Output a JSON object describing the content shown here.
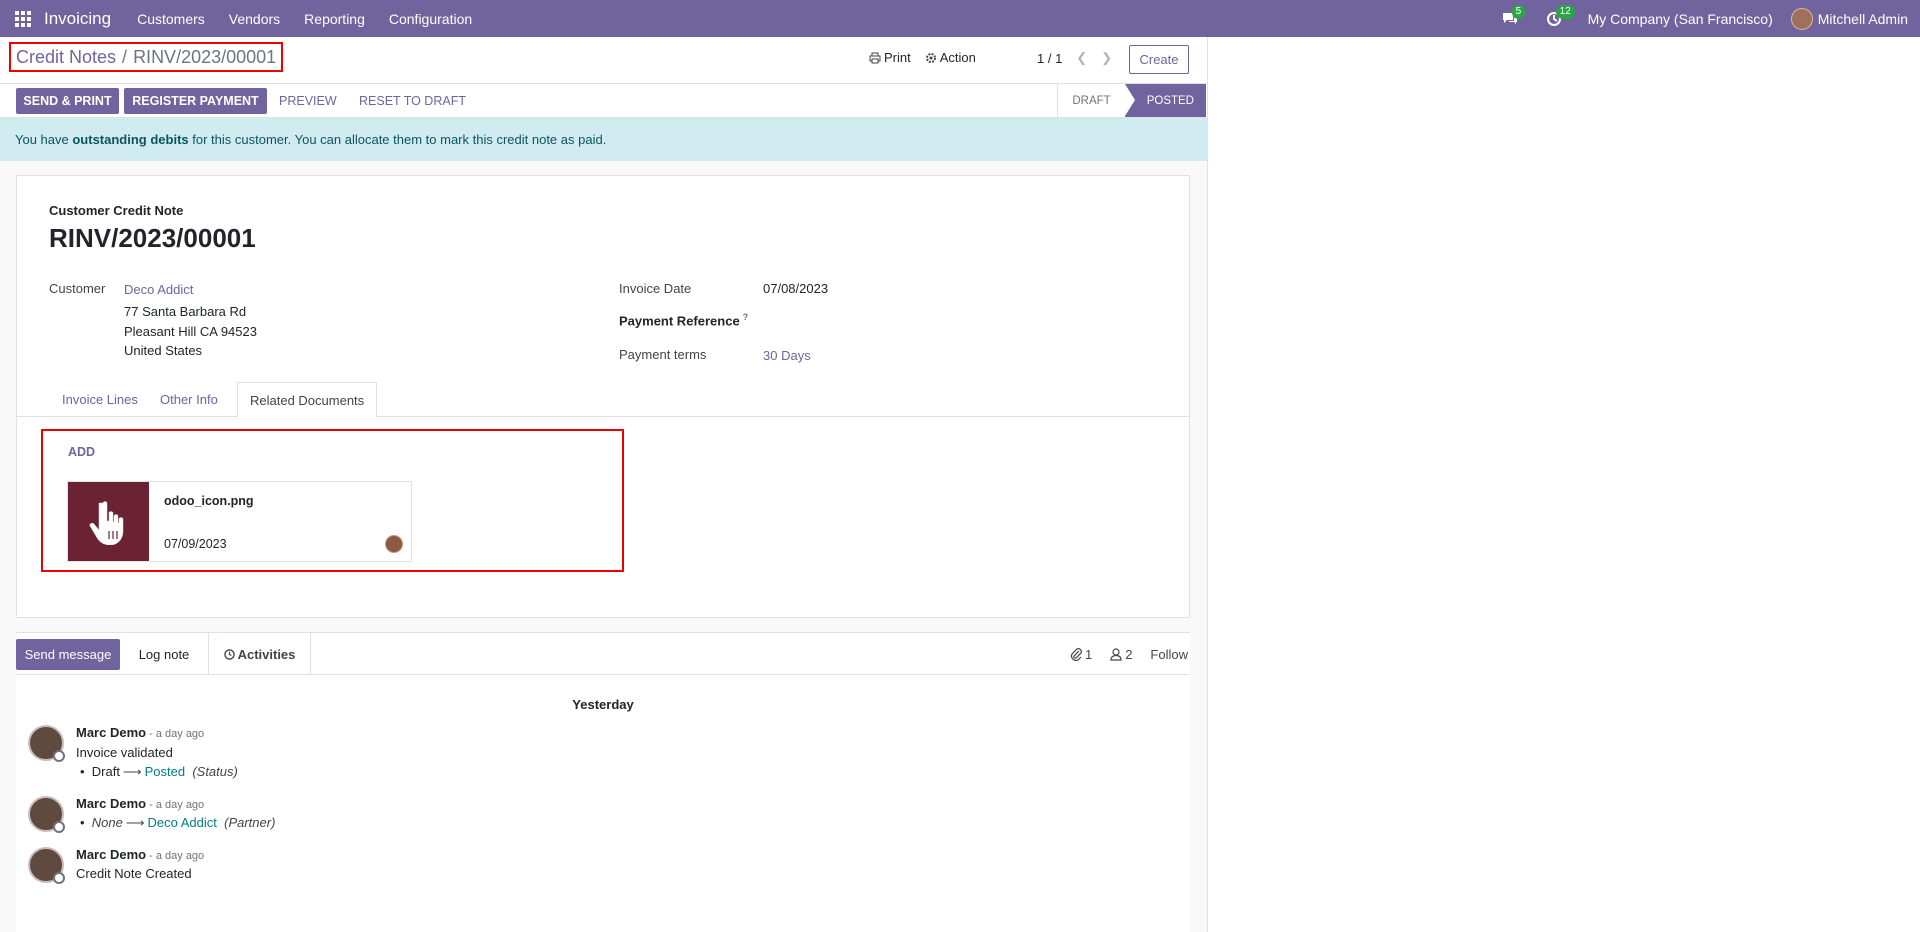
{
  "navbar": {
    "brand": "Invoicing",
    "menu": [
      "Customers",
      "Vendors",
      "Reporting",
      "Configuration"
    ],
    "messages_count": "5",
    "activities_count": "12",
    "company": "My Company (San Francisco)",
    "user": "Mitchell Admin"
  },
  "breadcrumb": {
    "parent": "Credit Notes",
    "separator": "/",
    "current": "RINV/2023/00001"
  },
  "cp": {
    "print": "Print",
    "action": "Action",
    "pager": "1 / 1",
    "create": "Create"
  },
  "statusbar": {
    "send_print": "SEND & PRINT",
    "register_payment": "REGISTER PAYMENT",
    "preview": "PREVIEW",
    "reset_draft": "RESET TO DRAFT",
    "stage_draft": "DRAFT",
    "stage_posted": "POSTED"
  },
  "alert": {
    "pre": "You have ",
    "bold": "outstanding debits",
    "post": " for this customer. You can allocate them to mark this credit note as paid."
  },
  "form": {
    "doc_type": "Customer Credit Note",
    "doc_number": "RINV/2023/00001",
    "customer_label": "Customer",
    "customer_name": "Deco Addict",
    "address_1": "77 Santa Barbara Rd",
    "address_2": "Pleasant Hill CA 94523",
    "address_3": "United States",
    "invoice_date_label": "Invoice Date",
    "invoice_date": "07/08/2023",
    "payment_ref_label": "Payment Reference",
    "payment_ref_help": "?",
    "payment_terms_label": "Payment terms",
    "payment_terms": "30 Days"
  },
  "tabs": [
    "Invoice Lines",
    "Other Info",
    "Related Documents"
  ],
  "attachments": {
    "add": "ADD",
    "file_name": "odoo_icon.png",
    "file_date": "07/09/2023"
  },
  "chatter": {
    "send_message": "Send message",
    "log_note": "Log note",
    "activities": "Activities",
    "attachments_count": "1",
    "followers_count": "2",
    "follow": "Follow",
    "day": "Yesterday",
    "messages": [
      {
        "author": "Marc Demo",
        "time": " - a day ago",
        "body": "Invoice validated",
        "old": "Draft",
        "new": "Posted",
        "field": "(Status)"
      },
      {
        "author": "Marc Demo",
        "time": " - a day ago",
        "old": "None",
        "new": "Deco Addict",
        "field": "(Partner)"
      },
      {
        "author": "Marc Demo",
        "time": " - a day ago",
        "body": "Credit Note Created"
      }
    ]
  }
}
